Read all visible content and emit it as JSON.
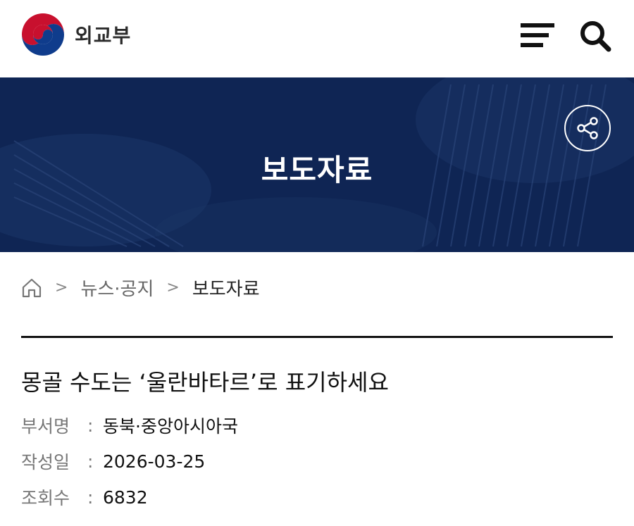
{
  "header": {
    "logo_text": "외교부",
    "menu_icon": "menu-icon",
    "search_icon": "search-icon"
  },
  "banner": {
    "title": "보도자료",
    "share_icon": "share-icon",
    "background_color": "#0f2554"
  },
  "breadcrumb": {
    "home_icon": "home-icon",
    "items": [
      "뉴스·공지",
      "보도자료"
    ]
  },
  "post": {
    "title": "몽골 수도는 ‘울란바타르’로 표기하세요",
    "meta": [
      {
        "label": "부서명",
        "value": "동북·중앙아시아국"
      },
      {
        "label": "작성일",
        "value": "2026-03-25"
      },
      {
        "label": "조회수",
        "value": "6832"
      }
    ]
  }
}
